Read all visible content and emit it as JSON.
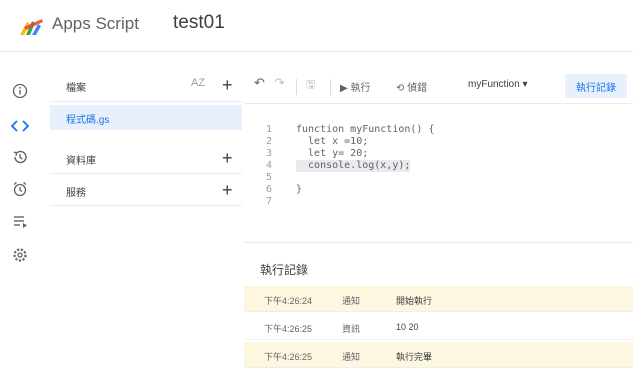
{
  "header": {
    "app_name": "Apps Script",
    "project_name": "test01",
    "logo_colors": [
      "#fbbc04",
      "#34a853",
      "#4285f4",
      "#ea4335"
    ]
  },
  "rail": {
    "items": [
      {
        "icon": "info-icon",
        "glyph": "ⓘ",
        "active": false
      },
      {
        "icon": "code-icon",
        "glyph": "<>",
        "active": true
      },
      {
        "icon": "history-icon",
        "glyph": "↺",
        "active": false
      },
      {
        "icon": "alarm-clock-icon",
        "glyph": "⏰",
        "active": false
      },
      {
        "icon": "executions-icon",
        "glyph": "≡",
        "active": false
      },
      {
        "icon": "settings-gear-icon",
        "glyph": "⚙",
        "active": false
      }
    ]
  },
  "files": {
    "title": "檔案",
    "sort_icon": "AZ",
    "add_icon": "+",
    "selected_file": "程式碼.gs",
    "sections": [
      {
        "label": "資料庫",
        "add_icon": "+"
      },
      {
        "label": "服務",
        "add_icon": "+"
      }
    ]
  },
  "toolbar": {
    "undo_icon": "↶",
    "redo_icon": "↷",
    "save_icon": "🖫",
    "run_label": "▶ 執行",
    "debug_label": "⟲ 偵錯",
    "function_select": "myFunction ▾",
    "exec_log_label": "執行記錄"
  },
  "editor": {
    "lines": [
      {
        "n": "1",
        "code": "function myFunction() {"
      },
      {
        "n": "2",
        "code": "  let x =10;"
      },
      {
        "n": "3",
        "code": "  let y= 20;"
      },
      {
        "n": "4",
        "code": "  console.log(x,y);"
      },
      {
        "n": "5",
        "code": ""
      },
      {
        "n": "6",
        "code": "}"
      },
      {
        "n": "7",
        "code": ""
      }
    ],
    "highlighted_line": 4
  },
  "log": {
    "title": "執行記錄",
    "rows": [
      {
        "time": "下午4:26:24",
        "level": "通知",
        "message": "開始執行",
        "notice": true
      },
      {
        "time": "下午4:26:25",
        "level": "資訊",
        "message": "10 20",
        "notice": false
      },
      {
        "time": "下午4:26:25",
        "level": "通知",
        "message": "執行完畢",
        "notice": true
      }
    ]
  }
}
